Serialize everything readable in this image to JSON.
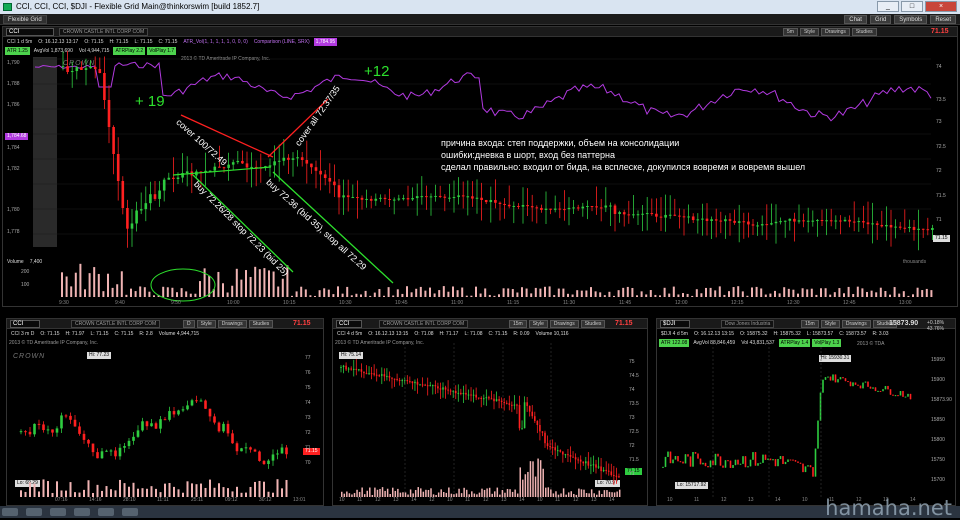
{
  "window": {
    "title": "CCI, CCI, CCI, $DJI - Flexible Grid Main@thinkorswim [build 1852.7]",
    "buttons": [
      "Chat",
      "Grid",
      "Symbols",
      "Reset"
    ]
  },
  "grid_tab": "Flexible Grid",
  "main_chart": {
    "symbol": "CCI",
    "company": "CROWN CASTLE INTL CORP COM",
    "last_price": "71.15",
    "info": [
      "CCI 1 d 5m",
      "O: 16.12.13 13:17",
      "O: 71.15",
      "H: 71.15",
      "L: 71.15",
      "C: 71.15"
    ],
    "studies_line": [
      "ATR 1.25",
      "AvgVol 1,873,690",
      "Vol 4,944,715",
      "ATRPlay 2.2",
      "VolPlay 1.7"
    ],
    "lower_line": [
      "ATR_Vol(1, 1, 1, 1, 1, 0, 0, 0)",
      "Comparison (LINE, SRX)",
      "1,784.95"
    ],
    "price_tag": "1,784.68",
    "left_axis": [
      "1,790",
      "1,788",
      "1,786",
      "1,784",
      "1,782",
      "1,780",
      "1,778"
    ],
    "right_axis": [
      "74",
      "73.5",
      "73",
      "72.5",
      "72",
      "71.5",
      "71"
    ],
    "last_tag": "71.15",
    "copyright": "2013 © TD Ameritrade IP Company, Inc.",
    "logo": "CROWN",
    "volume_label": "Volume",
    "volume_value": "7,400",
    "volume_unit": "thousands",
    "vol_axis": [
      "200",
      "100"
    ],
    "times": [
      "9:30",
      "9:40",
      "9:50",
      "10:00",
      "10:15",
      "10:30",
      "10:45",
      "11:00",
      "11:15",
      "11:30",
      "11:45",
      "12:00",
      "12:15",
      "12:30",
      "12:45",
      "13:00"
    ]
  },
  "annotations": {
    "plus19": "+ 19",
    "plus12": "+12",
    "cover1": "cover 100/72.49",
    "cover2": "cover all 72.37/35",
    "buy1": "buy 72.26/28 stop 72.23 (bid 25)",
    "buy2": "buy 72.36 (bid 35), stop all 72.29",
    "notes": [
      "причина входа: степ поддержки, объем на консолидации",
      "ошибки:дневка в шорт, вход без паттерна",
      "сделал правильно: входил от бида, на  всплеске, докупился вовремя и вовремя вышел"
    ]
  },
  "p1": {
    "symbol": "CCI",
    "company": "CROWN CASTLE INTL CORP COM",
    "price": "71.15",
    "agg": "D",
    "info": [
      "CCI 3 m D",
      "O: 71.15",
      "H: 71.97",
      "L: 71.15",
      "C: 71.15",
      "R: 2.8",
      "Volume 4,944,715"
    ],
    "hi": "Hi: 77.23",
    "lo": "Lo: 69.29",
    "axis": [
      "77",
      "76",
      "75",
      "74",
      "73",
      "72",
      "71",
      "70"
    ],
    "dates": [
      "07:16",
      "14:16",
      "28:10",
      "11:11",
      "25:11",
      "09:12",
      "30:12",
      "13:01"
    ],
    "logo": "CROWN",
    "copy": "2013 © TD Ameritrade IP Company, Inc."
  },
  "p2": {
    "symbol": "CCI",
    "company": "CROWN CASTLE INTL CORP COM",
    "price": "71.15",
    "agg": "15m",
    "info": [
      "CCI 4 d 5m",
      "O: 16.12.13 13:15",
      "O: 71.08",
      "H: 71.17",
      "L: 71.08",
      "C: 71.15",
      "R: 0.09",
      "Volume 10,116"
    ],
    "hi": "Hi: 75.14",
    "lo": "Lo: 70.97",
    "axis": [
      "75",
      "74.5",
      "74",
      "73.5",
      "73",
      "72.5",
      "72",
      "71.5",
      "71"
    ],
    "dates": [
      "10",
      "11",
      "12",
      "13",
      "14",
      "12",
      "10",
      "11",
      "12",
      "13",
      "14",
      "10",
      "11",
      "12",
      "13",
      "14"
    ],
    "copy": "2013 © TD Ameritrade IP Company, Inc."
  },
  "p3": {
    "symbol": "$DJI",
    "company": "Dow Jones Industria",
    "price": "15873.90",
    "pct": "+0.18% 43.76%",
    "agg": "15m",
    "info": [
      "$DJI 4 d 5m",
      "O: 16.12.13 13:15",
      "O: 15875.32",
      "H: 15875.32",
      "L: 15873.57",
      "C: 15873.57",
      "R: 3.03"
    ],
    "study": [
      "ATR 122.08",
      "AvgVol 88,846,459",
      "Vol 43,831,537",
      "ATRPlay 1.4",
      "VolPlay 1.3"
    ],
    "hi": "Hi: 15930.31",
    "lo": "Lo: 15717.92",
    "axis": [
      "15950",
      "15900",
      "15873.90",
      "15850",
      "15800",
      "15750",
      "15700"
    ],
    "dates": [
      "10",
      "11",
      "12",
      "13",
      "14",
      "10",
      "11",
      "12",
      "13",
      "14"
    ],
    "copy": "2013 © TDA"
  },
  "chart_data": {
    "type": "line",
    "title": "CCI 1 d 5m",
    "ylim": [
      71,
      74
    ],
    "x": [
      "9:30",
      "10:00",
      "10:15",
      "10:30",
      "11:00",
      "11:30",
      "12:00",
      "12:30",
      "13:00"
    ],
    "series": [
      {
        "values": [
          72.2,
          72.36,
          72.47,
          71.9,
          71.75,
          71.6,
          71.35,
          71.4,
          71.15
        ]
      }
    ]
  },
  "colors": {
    "up": "#2ecc40",
    "down": "#ff2020",
    "comparison": "#b23ae0",
    "annot_green": "#2de02d",
    "annot_red": "#ff2020"
  }
}
